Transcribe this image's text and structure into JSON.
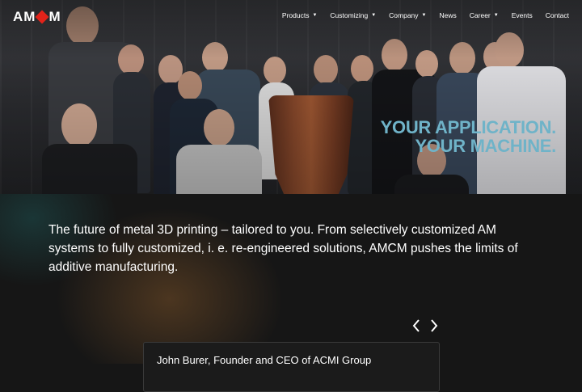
{
  "brand": {
    "logo_left": "AM",
    "logo_right": "M",
    "accent_color": "#e2231a"
  },
  "nav": {
    "items": [
      {
        "label": "Products",
        "has_dropdown": true,
        "icon": "chevron-down-icon"
      },
      {
        "label": "Customizing",
        "has_dropdown": true,
        "icon": "chevron-down-icon"
      },
      {
        "label": "Company",
        "has_dropdown": true,
        "icon": "chevron-down-icon"
      },
      {
        "label": "News",
        "has_dropdown": false
      },
      {
        "label": "Career",
        "has_dropdown": true,
        "icon": "chevron-down-icon"
      },
      {
        "label": "Events",
        "has_dropdown": false
      },
      {
        "label": "Contact",
        "has_dropdown": false
      }
    ]
  },
  "hero": {
    "tagline_line1": "YOUR APPLICATION.",
    "tagline_line2": "YOUR MACHINE.",
    "tagline_color": "#6fb3c8"
  },
  "intro": {
    "text": "The future of metal 3D printing – tailored to you. From selectively customized AM systems to fully customized, i. e. re-engineered solutions, AMCM pushes the limits of additive manufacturing."
  },
  "carousel": {
    "prev_icon": "chevron-left-icon",
    "next_icon": "chevron-right-icon",
    "card_name": "John Burer, Founder and CEO of ACMI Group"
  }
}
